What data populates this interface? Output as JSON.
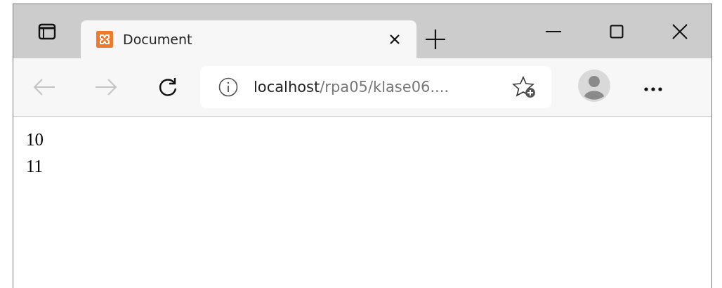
{
  "tabs": [
    {
      "title": "Document",
      "selected": true
    }
  ],
  "address": {
    "host": "localhost",
    "path": "/rpa05/klase06...."
  },
  "content": {
    "lines": [
      "10",
      "11"
    ]
  }
}
